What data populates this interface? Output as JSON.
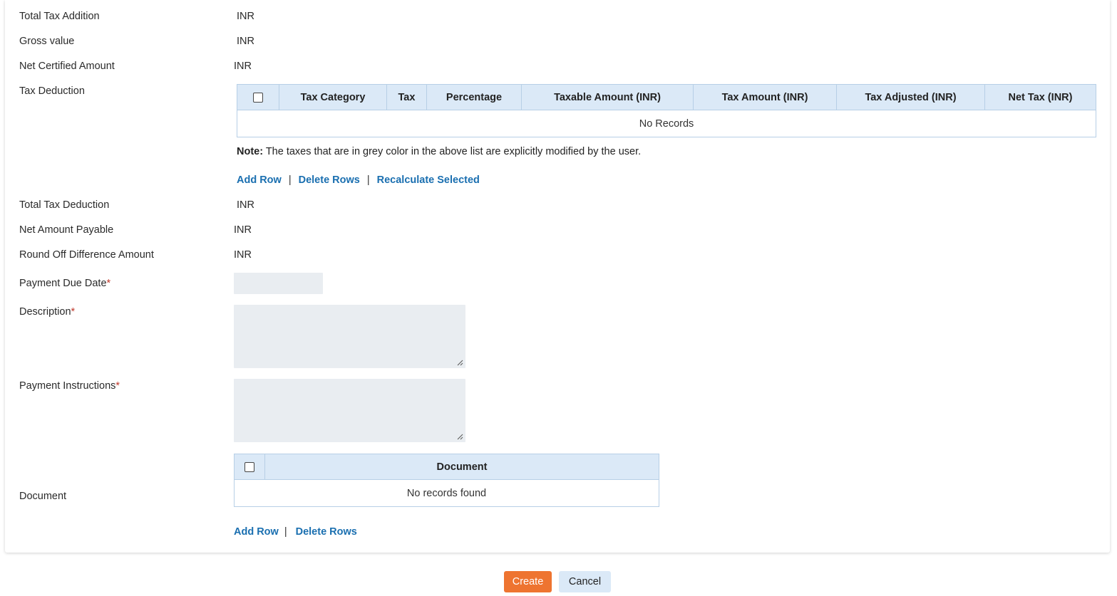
{
  "fields": {
    "total_tax_addition": {
      "label": "Total Tax Addition",
      "value": "INR"
    },
    "gross_value": {
      "label": "Gross value",
      "value": "INR"
    },
    "net_certified_amount": {
      "label": "Net Certified Amount",
      "value": "INR"
    },
    "tax_deduction": {
      "label": "Tax Deduction"
    },
    "total_tax_deduction": {
      "label": "Total Tax Deduction",
      "value": "INR"
    },
    "net_amount_payable": {
      "label": "Net Amount Payable",
      "value": "INR"
    },
    "round_off_difference": {
      "label": "Round Off Difference Amount",
      "value": "INR"
    },
    "payment_due_date": {
      "label": "Payment Due Date",
      "required": "*",
      "value": ""
    },
    "description": {
      "label": "Description",
      "required": "*",
      "value": ""
    },
    "payment_instructions": {
      "label": "Payment Instructions",
      "required": "*",
      "value": ""
    },
    "document": {
      "label": "Document"
    }
  },
  "tax_table": {
    "columns": [
      "Tax Category",
      "Tax",
      "Percentage",
      "Taxable Amount (INR)",
      "Tax Amount (INR)",
      "Tax Adjusted (INR)",
      "Net Tax (INR)"
    ],
    "empty_text": "No Records"
  },
  "note": {
    "bold": "Note:",
    "text": " The taxes that are in grey color in the above list are explicitly modified by the user."
  },
  "tax_actions": {
    "add_row": "Add Row",
    "delete_rows": "Delete Rows",
    "recalculate": "Recalculate Selected",
    "separator": "|"
  },
  "doc_table": {
    "columns": [
      "Document"
    ],
    "empty_text": "No records found"
  },
  "doc_actions": {
    "add_row": "Add Row",
    "delete_rows": "Delete Rows",
    "separator": "|"
  },
  "footer": {
    "create": "Create",
    "cancel": "Cancel"
  },
  "colors": {
    "accent": "#ee7430",
    "link": "#1a6fb0",
    "header_bg": "#dbe9f7",
    "field_bg": "#e9edf1"
  }
}
